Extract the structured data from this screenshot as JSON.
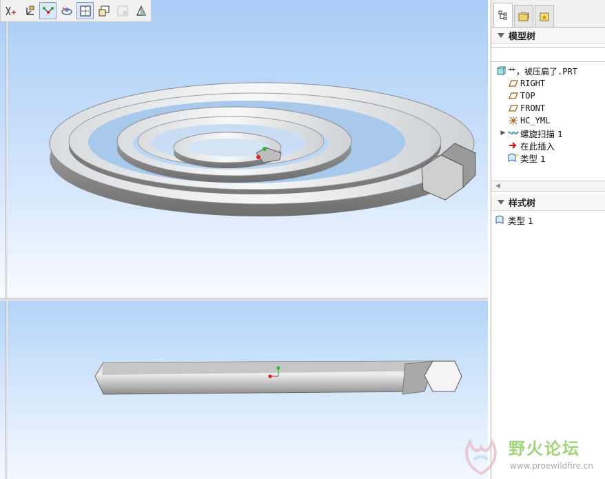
{
  "toolbar": {
    "buttons": [
      {
        "icon": "datum-display-icon",
        "active": false
      },
      {
        "icon": "coordinate-system-icon",
        "active": false
      },
      {
        "icon": "datum-point-icon",
        "active": true
      },
      {
        "icon": "spin-center-icon",
        "active": false
      },
      {
        "icon": "view-frame-icon",
        "active": true
      },
      {
        "icon": "saved-views-icon",
        "active": false
      },
      {
        "icon": "layout-icon",
        "active": false,
        "disabled": true
      },
      {
        "icon": "shading-mode-icon",
        "active": false
      }
    ]
  },
  "navigator": {
    "tabs": [
      {
        "icon": "model-tree-tab-icon",
        "active": true
      },
      {
        "icon": "folder-browser-tab-icon",
        "active": false
      },
      {
        "icon": "favorites-tab-icon",
        "active": false
      }
    ],
    "model_tree": {
      "title": "模型树",
      "items": [
        {
          "label": "艹，被压扁了.PRT",
          "icon": "part-icon",
          "indent": 0,
          "mono": true
        },
        {
          "label": "RIGHT",
          "icon": "datum-plane-icon",
          "indent": 1,
          "mono": true
        },
        {
          "label": "TOP",
          "icon": "datum-plane-icon",
          "indent": 1,
          "mono": true
        },
        {
          "label": "FRONT",
          "icon": "datum-plane-icon",
          "indent": 1,
          "mono": true
        },
        {
          "label": "HC_YML",
          "icon": "csys-icon",
          "indent": 1,
          "mono": true
        },
        {
          "label": "螺旋扫描 1",
          "icon": "helical-sweep-icon",
          "indent": 1,
          "expandable": true
        },
        {
          "label": "在此插入",
          "icon": "insert-here-arrow-icon",
          "indent": 1
        },
        {
          "label": "类型 1",
          "icon": "style-type-icon",
          "indent": 1
        }
      ]
    },
    "style_tree": {
      "title": "样式树",
      "items": [
        {
          "label": "类型 1",
          "icon": "style-type-icon"
        }
      ]
    }
  },
  "watermark": {
    "title": "野火论坛",
    "url": "www.proewildfire.cn"
  },
  "colors": {
    "viewport_top": "#a9cdf6",
    "viewport_bottom": "#f6fbff",
    "model_gray": "#c8c8c8",
    "watermark_green": "#9fd67a"
  }
}
